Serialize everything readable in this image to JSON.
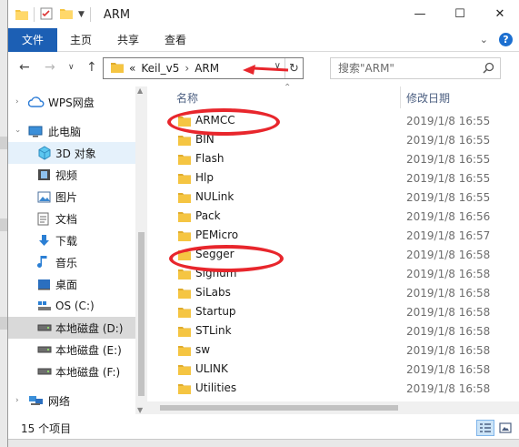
{
  "window": {
    "title": "ARM",
    "controls": {
      "minimize": "—",
      "maximize": "☐",
      "close": "✕"
    }
  },
  "ribbon": {
    "tabs": [
      {
        "label": "文件",
        "active": true
      },
      {
        "label": "主页"
      },
      {
        "label": "共享"
      },
      {
        "label": "查看"
      }
    ]
  },
  "address": {
    "overflow": "«",
    "breadcrumbs": [
      "Keil_v5",
      "ARM"
    ],
    "separator": "›",
    "search_placeholder": "搜索\"ARM\""
  },
  "nav_pane": {
    "items": [
      {
        "label": "WPS网盘",
        "icon": "cloud-icon"
      },
      {
        "label": "此电脑",
        "icon": "computer-icon"
      },
      {
        "label": "3D 对象",
        "icon": "cube-icon",
        "highlight": true
      },
      {
        "label": "视频",
        "icon": "video-icon"
      },
      {
        "label": "图片",
        "icon": "picture-icon"
      },
      {
        "label": "文档",
        "icon": "document-icon"
      },
      {
        "label": "下载",
        "icon": "download-icon"
      },
      {
        "label": "音乐",
        "icon": "music-icon"
      },
      {
        "label": "桌面",
        "icon": "desktop-icon"
      },
      {
        "label": "OS (C:)",
        "icon": "drive-icon"
      },
      {
        "label": "本地磁盘 (D:)",
        "icon": "drive-icon",
        "selected": true
      },
      {
        "label": "本地磁盘 (E:)",
        "icon": "drive-icon"
      },
      {
        "label": "本地磁盘 (F:)",
        "icon": "drive-icon"
      },
      {
        "label": "网络",
        "icon": "network-icon"
      }
    ]
  },
  "file_list": {
    "columns": {
      "name": "名称",
      "modified": "修改日期"
    },
    "rows": [
      {
        "name": "ARMCC",
        "modified": "2019/1/8 16:55"
      },
      {
        "name": "BIN",
        "modified": "2019/1/8 16:55"
      },
      {
        "name": "Flash",
        "modified": "2019/1/8 16:55"
      },
      {
        "name": "Hlp",
        "modified": "2019/1/8 16:55"
      },
      {
        "name": "NULink",
        "modified": "2019/1/8 16:55"
      },
      {
        "name": "Pack",
        "modified": "2019/1/8 16:56"
      },
      {
        "name": "PEMicro",
        "modified": "2019/1/8 16:57"
      },
      {
        "name": "Segger",
        "modified": "2019/1/8 16:58"
      },
      {
        "name": "Signum",
        "modified": "2019/1/8 16:58"
      },
      {
        "name": "SiLabs",
        "modified": "2019/1/8 16:58"
      },
      {
        "name": "Startup",
        "modified": "2019/1/8 16:58"
      },
      {
        "name": "STLink",
        "modified": "2019/1/8 16:58"
      },
      {
        "name": "sw",
        "modified": "2019/1/8 16:58"
      },
      {
        "name": "ULINK",
        "modified": "2019/1/8 16:58"
      },
      {
        "name": "Utilities",
        "modified": "2019/1/8 16:58"
      }
    ]
  },
  "status": {
    "item_count": "15 个项目"
  },
  "colors": {
    "accent": "#1c5fb4",
    "folder": "#f5c542",
    "annotation": "#e8262c"
  }
}
